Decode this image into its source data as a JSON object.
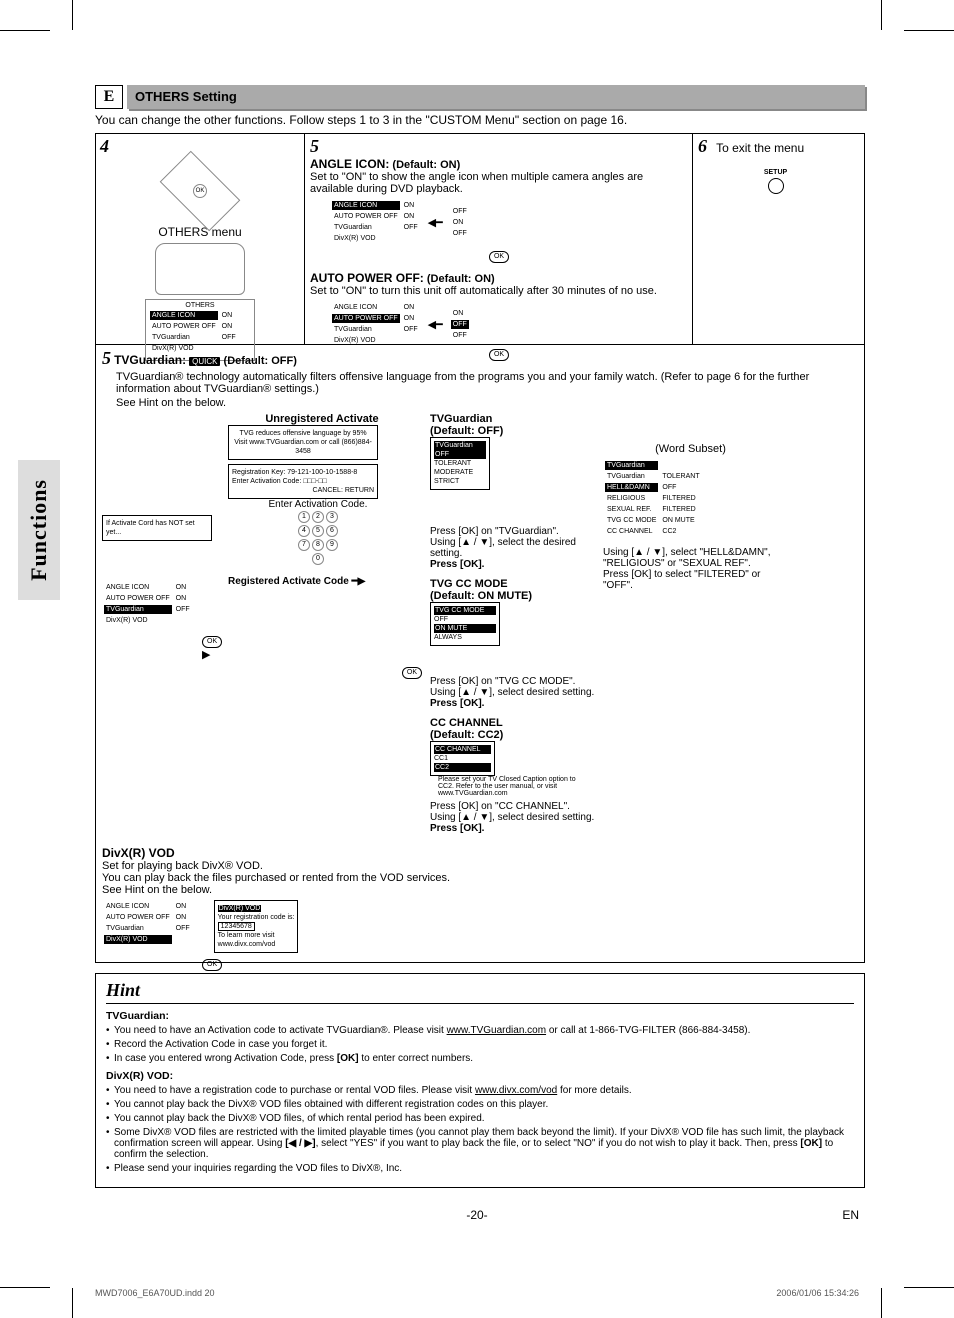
{
  "section_tab": "Functions",
  "header": {
    "letter": "E",
    "title": "OTHERS Setting"
  },
  "intro": "You can change the other functions. Follow steps 1 to 3 in the \"CUSTOM Menu\" section on page 16.",
  "step4": {
    "num": "4",
    "label": "OTHERS menu",
    "menu_title": "OTHERS",
    "items": [
      {
        "name": "ANGLE ICON",
        "val": "ON",
        "hl": true
      },
      {
        "name": "AUTO POWER OFF",
        "val": "ON"
      },
      {
        "name": "TVGuardian",
        "val": "OFF"
      },
      {
        "name": "DivX(R) VOD",
        "val": ""
      }
    ]
  },
  "step5": {
    "num": "5",
    "angle": {
      "title": "ANGLE ICON:",
      "default": "(Default: ON)",
      "desc": "Set to \"ON\" to show the angle icon when multiple camera angles are available during DVD playback.",
      "menu_left": [
        {
          "name": "ANGLE ICON",
          "val": "ON",
          "hl": true
        },
        {
          "name": "AUTO POWER OFF",
          "val": "ON"
        },
        {
          "name": "TVGuardian",
          "val": "OFF"
        },
        {
          "name": "DivX(R) VOD",
          "val": ""
        }
      ],
      "menu_right": [
        "OFF",
        "ON",
        "OFF"
      ]
    },
    "autopower": {
      "title": "AUTO POWER OFF:",
      "default": "(Default: ON)",
      "desc": "Set to \"ON\" to turn this unit off automatically after 30 minutes of no use.",
      "menu_left": [
        {
          "name": "ANGLE ICON",
          "val": "ON"
        },
        {
          "name": "AUTO POWER OFF",
          "val": "ON",
          "hl": true
        },
        {
          "name": "TVGuardian",
          "val": "OFF"
        },
        {
          "name": "DivX(R) VOD",
          "val": ""
        }
      ],
      "menu_right": [
        "ON",
        "OFF",
        "OFF"
      ]
    }
  },
  "step6": {
    "num": "6",
    "text": "To exit the menu",
    "btn": "SETUP"
  },
  "tvg": {
    "num": "5",
    "title": "TVGuardian:",
    "quick": "QUICK",
    "default": "(Default: OFF)",
    "desc": "TVGuardian® technology automatically filters offensive language from the programs you and your family watch. (Refer to page 6 for the further information about TVGuardian® settings.)",
    "hint_ref": "See Hint on the below.",
    "unreg_label": "Unregistered Activate",
    "tvg_box1": "TVG reduces offensive language by 95% Visit www.TVGuardian.com or call (866)884-3458",
    "tvg_box2_l1": "Registration Key:",
    "tvg_box2_l1v": "79-121-100-10-1588-8",
    "tvg_box2_l2": "Enter Activation Code:",
    "tvg_box2_l2v": "□□□-□□",
    "tvg_box2_cancel": "CANCEL: RETURN",
    "enter_ac": "Enter Activation Code.",
    "if_not_set": "If Activate Cord has NOT set yet...",
    "menu_reg": [
      {
        "name": "ANGLE ICON",
        "val": "ON"
      },
      {
        "name": "AUTO POWER OFF",
        "val": "ON"
      },
      {
        "name": "TVGuardian",
        "val": "OFF",
        "hl": true
      },
      {
        "name": "DivX(R) VOD",
        "val": ""
      }
    ],
    "reg_label": "Registered Activate Code",
    "keypad": [
      "1",
      "2",
      "3",
      "4",
      "5",
      "6",
      "7",
      "8",
      "9",
      "0"
    ],
    "tvguardian_col": {
      "title": "TVGuardian",
      "default": "(Default: OFF)",
      "menu": [
        "TVGuardian",
        "OFF",
        "TOLERANT",
        "MODERATE",
        "STRICT"
      ],
      "instr1": "Press [OK] on \"TVGuardian\".",
      "instr2": "Using [▲ / ▼], select the desired setting.",
      "instr3": "Press [OK].",
      "cc_title": "TVG CC MODE",
      "cc_default": "(Default: ON MUTE)",
      "cc_menu": [
        "TVG CC MODE",
        "OFF",
        "ON MUTE",
        "ALWAYS"
      ],
      "cc_instr1": "Press [OK] on \"TVG CC MODE\".",
      "cc_instr2": "Using [▲ / ▼], select desired setting.",
      "cc_instr3": "Press [OK].",
      "ccch_title": "CC CHANNEL",
      "ccch_default": "(Default: CC2)",
      "ccch_menu": [
        "CC CHANNEL",
        "CC1",
        "CC2"
      ],
      "ccch_note": "Please set your TV Closed Caption option to CC2. Refer to the user manual, or visit www.TVGuardian.com",
      "ccch_instr1": "Press [OK] on \"CC CHANNEL\".",
      "ccch_instr2": "Using [▲ / ▼], select desired setting.",
      "ccch_instr3": "Press [OK]."
    },
    "word_subset": {
      "label": "(Word Subset)",
      "menu_left": [
        "TVGuardian",
        "TVGuardian",
        "HELL&DAMN",
        "RELIGIOUS",
        "SEXUAL REF.",
        "TVG CC MODE",
        "CC CHANNEL"
      ],
      "menu_right": [
        "",
        "TOLERANT",
        "OFF",
        "FILTERED",
        "FILTERED",
        "ON MUTE",
        "CC2"
      ],
      "instr1": "Using [▲ / ▼], select \"HELL&DAMN\", \"RELIGIOUS\" or \"SEXUAL REF\".",
      "instr2": "Press [OK] to select \"FILTERED\" or \"OFF\"."
    }
  },
  "divx": {
    "title": "DivX(R) VOD",
    "l1": "Set for playing back DivX® VOD.",
    "l2": "You can play back the files purchased or rented from the VOD services.",
    "hint_ref": "See Hint on the below.",
    "menu": [
      {
        "name": "ANGLE ICON",
        "val": "ON"
      },
      {
        "name": "AUTO POWER OFF",
        "val": "ON"
      },
      {
        "name": "TVGuardian",
        "val": "OFF"
      },
      {
        "name": "DivX(R) VOD",
        "val": "",
        "hl": true
      }
    ],
    "box_title": "DivX(R) VOD",
    "box_l1": "Your registration code is:",
    "box_code": "12345678",
    "box_l2": "To learn more visit",
    "box_url": "www.divx.com/vod"
  },
  "hint": {
    "title": "Hint",
    "tvg_head": "TVGuardian:",
    "tvg": [
      "You need to have an Activation code to activate TVGuardian®. Please visit www.TVGuardian.com or call at 1-866-TVG-FILTER (866-884-3458).",
      "Record the Activation Code in case you forget it.",
      "In case you entered wrong Activation Code, press [OK] to enter correct numbers."
    ],
    "divx_head": "DivX(R) VOD:",
    "divx": [
      "You need to have a registration code to purchase or rental VOD files. Please visit www.divx.com/vod for more details.",
      "You cannot play back the DivX® VOD files obtained with different registration codes on this player.",
      "You cannot play back the DivX® VOD files, of which rental period has been expired.",
      "Some DivX® VOD files are restricted with the limited playable times (you cannot play them back beyond the limit). If your DivX® VOD file has such limit, the playback confirmation screen will appear. Using [◀ / ▶], select \"YES\" if you want to play back the file, or to select \"NO\" if you do not wish to play it back. Then, press [OK] to confirm the selection.",
      "Please send your inquiries regarding the VOD files to DivX®, Inc."
    ]
  },
  "footer": {
    "page": "-20-",
    "lang": "EN",
    "meta_l": "MWD7006_E6A70UD.indd   20",
    "meta_r": "2006/01/06   15:34:26"
  },
  "ok": "OK"
}
